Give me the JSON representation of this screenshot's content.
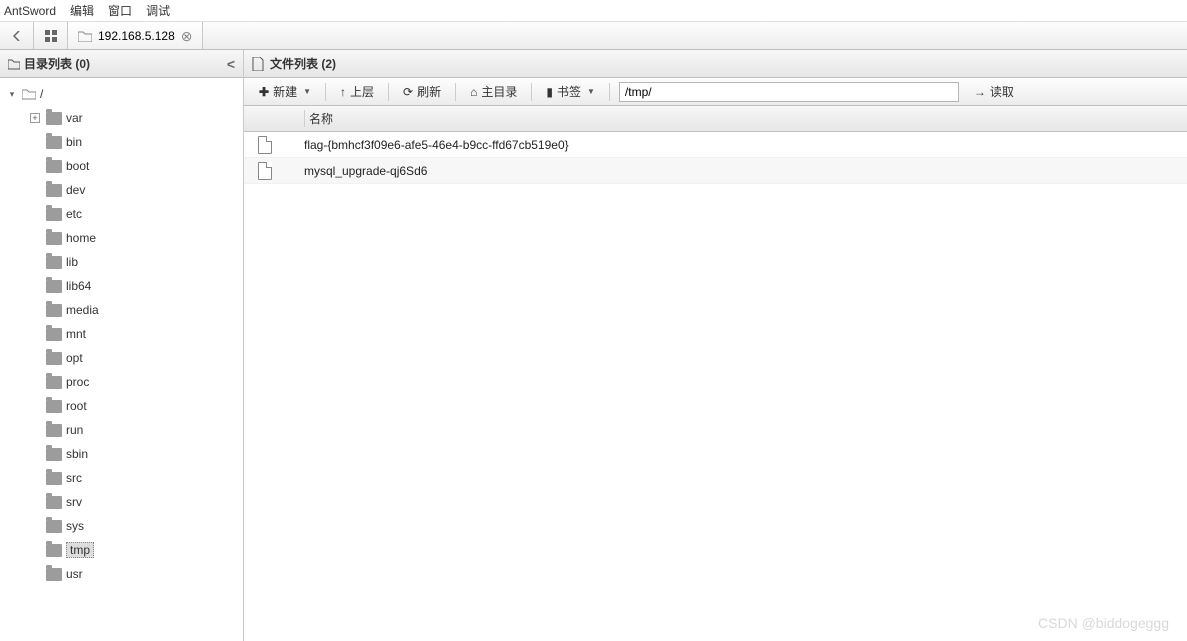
{
  "menubar": {
    "app": "AntSword",
    "items": [
      "编辑",
      "窗口",
      "调试"
    ]
  },
  "tabs": {
    "main_ip": "192.168.5.128"
  },
  "sidebar": {
    "title": "目录列表 (0)",
    "root": "/",
    "items": [
      {
        "name": "var",
        "expandable": true
      },
      {
        "name": "bin"
      },
      {
        "name": "boot"
      },
      {
        "name": "dev"
      },
      {
        "name": "etc"
      },
      {
        "name": "home"
      },
      {
        "name": "lib"
      },
      {
        "name": "lib64"
      },
      {
        "name": "media"
      },
      {
        "name": "mnt"
      },
      {
        "name": "opt"
      },
      {
        "name": "proc"
      },
      {
        "name": "root"
      },
      {
        "name": "run"
      },
      {
        "name": "sbin"
      },
      {
        "name": "src"
      },
      {
        "name": "srv"
      },
      {
        "name": "sys"
      },
      {
        "name": "tmp",
        "selected": true
      },
      {
        "name": "usr"
      }
    ]
  },
  "content": {
    "title": "文件列表 (2)",
    "toolbar": {
      "new": "新建",
      "up": "上层",
      "refresh": "刷新",
      "home": "主目录",
      "bookmark": "书签",
      "read": "读取"
    },
    "path": "/tmp/",
    "col_name": "名称",
    "files": [
      {
        "name": "flag-{bmhcf3f09e6-afe5-46e4-b9cc-ffd67cb519e0}"
      },
      {
        "name": "mysql_upgrade-qj6Sd6"
      }
    ]
  },
  "watermark": "CSDN @biddogeggg"
}
